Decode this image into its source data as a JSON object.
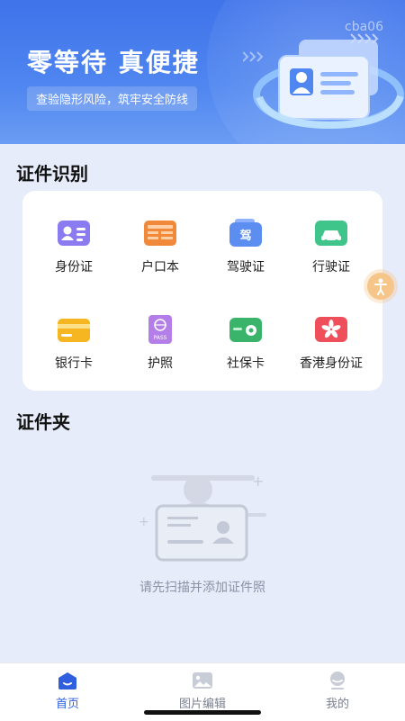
{
  "banner": {
    "title": "零等待 真便捷",
    "subtitle": "查验隐形风险，筑牢安全防线",
    "watermark": "cba06"
  },
  "recognition": {
    "title": "证件识别",
    "items": [
      {
        "label": "身份证",
        "icon": "id-card-icon",
        "color": "#8a7cf0"
      },
      {
        "label": "户口本",
        "icon": "household-register-icon",
        "color": "#f08a3a"
      },
      {
        "label": "驾驶证",
        "icon": "driver-license-icon",
        "color": "#5b8ef0"
      },
      {
        "label": "行驶证",
        "icon": "vehicle-license-icon",
        "color": "#3fc48a"
      },
      {
        "label": "银行卡",
        "icon": "bank-card-icon",
        "color": "#f5b622"
      },
      {
        "label": "护照",
        "icon": "passport-icon",
        "color": "#b47ee8"
      },
      {
        "label": "社保卡",
        "icon": "social-security-card-icon",
        "color": "#3ab46a"
      },
      {
        "label": "香港身份证",
        "icon": "hk-id-card-icon",
        "color": "#ef4f5a"
      }
    ]
  },
  "folder": {
    "title": "证件夹",
    "empty_text": "请先扫描并添加证件照"
  },
  "tabbar": {
    "tabs": [
      {
        "label": "首页",
        "icon": "home-icon",
        "active": true
      },
      {
        "label": "图片编辑",
        "icon": "image-icon",
        "active": false
      },
      {
        "label": "我的",
        "icon": "profile-icon",
        "active": false
      }
    ],
    "active_color": "#2f5fdf"
  }
}
